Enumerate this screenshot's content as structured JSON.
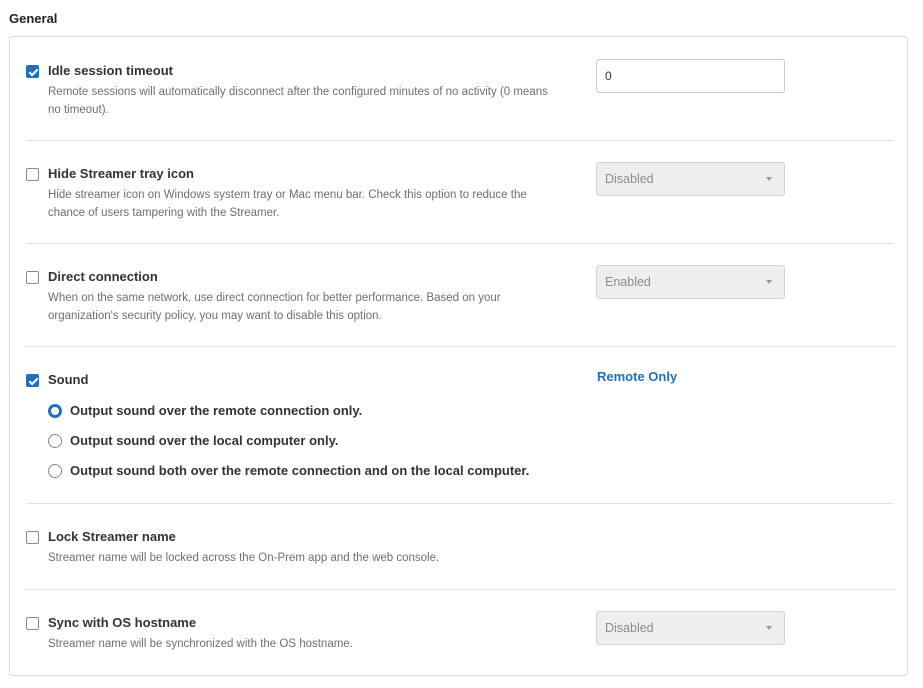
{
  "section": {
    "title": "General"
  },
  "settings": {
    "idle_timeout": {
      "label": "Idle session timeout",
      "checked": true,
      "description": "Remote sessions will automatically disconnect after the configured minutes of no activity (0 means no timeout).",
      "value": "0"
    },
    "hide_tray_icon": {
      "label": "Hide Streamer tray icon",
      "checked": false,
      "description": "Hide streamer icon on Windows system tray or Mac menu bar. Check this option to reduce the chance of users tampering with the Streamer.",
      "value": "Disabled"
    },
    "direct_connection": {
      "label": "Direct connection",
      "checked": false,
      "description": "When on the same network, use direct connection for better performance. Based on your organization's security policy, you may want to disable this option.",
      "value": "Enabled"
    },
    "sound": {
      "label": "Sound",
      "checked": true,
      "value": "Remote Only",
      "options": [
        {
          "label": "Output sound over the remote connection only.",
          "selected": true
        },
        {
          "label": "Output sound over the local computer only.",
          "selected": false
        },
        {
          "label": "Output sound both over the remote connection and on the local computer.",
          "selected": false
        }
      ]
    },
    "lock_name": {
      "label": "Lock Streamer name",
      "checked": false,
      "description": "Streamer name will be locked across the On-Prem app and the web console."
    },
    "sync_hostname": {
      "label": "Sync with OS hostname",
      "checked": false,
      "description": "Streamer name will be synchronized with the OS hostname.",
      "value": "Disabled"
    }
  },
  "colors": {
    "accent": "#1f6fc5",
    "divider": "#e3e3e3",
    "disabled_bg": "#eeeeee"
  }
}
